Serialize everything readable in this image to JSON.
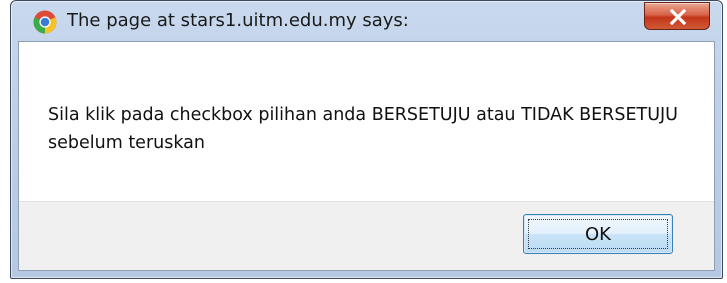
{
  "dialog": {
    "title": "The page at stars1.uitm.edu.my says:",
    "message": "Sila klik pada checkbox pilihan anda BERSETUJU atau TIDAK BERSETUJU sebelum teruskan",
    "ok_label": "OK",
    "close_symbol": "x",
    "icons": {
      "app": "chrome-icon",
      "close": "close-icon"
    }
  }
}
